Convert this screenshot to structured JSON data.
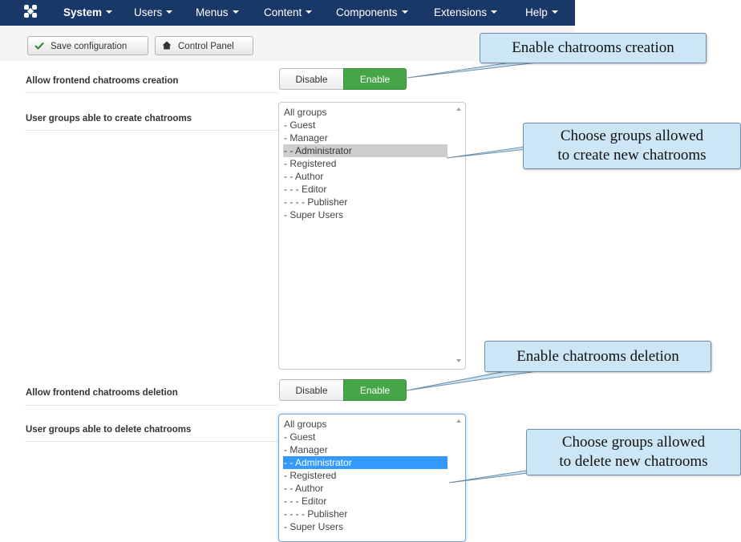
{
  "navbar": {
    "logo_icon": "joomla-logo-icon",
    "items": [
      {
        "label": "System",
        "active": true
      },
      {
        "label": "Users"
      },
      {
        "label": "Menus"
      },
      {
        "label": "Content"
      },
      {
        "label": "Components"
      },
      {
        "label": "Extensions"
      },
      {
        "label": "Help"
      }
    ]
  },
  "toolbar": {
    "save_label": "Save configuration",
    "save_icon": "checkmark-icon",
    "control_panel_label": "Control Panel",
    "control_panel_icon": "home-icon"
  },
  "form": {
    "allow_creation": {
      "label": "Allow frontend chatrooms creation",
      "disable_label": "Disable",
      "enable_label": "Enable",
      "value": "Enable"
    },
    "create_groups": {
      "label": "User groups able to create chatrooms",
      "options": [
        "All groups",
        "- Guest",
        "- Manager",
        "- - Administrator",
        "- Registered",
        "- - Author",
        "- - - Editor",
        "- - - - Publisher",
        "- Super Users"
      ],
      "selected": "- - Administrator"
    },
    "allow_deletion": {
      "label": "Allow frontend chatrooms deletion",
      "disable_label": "Disable",
      "enable_label": "Enable",
      "value": "Enable"
    },
    "delete_groups": {
      "label": "User groups able to delete chatrooms",
      "options": [
        "All groups",
        "- Guest",
        "- Manager",
        "- - Administrator",
        "- Registered",
        "- - Author",
        "- - - Editor",
        "- - - - Publisher",
        "- Super Users"
      ],
      "selected": "- - Administrator"
    }
  },
  "callouts": {
    "enable_creation": "Enable chatrooms creation",
    "choose_create_line1": "Choose groups allowed",
    "choose_create_line2": "to create new chatrooms",
    "enable_deletion": "Enable chatrooms deletion",
    "choose_delete_line1": "Choose groups allowed",
    "choose_delete_line2": "to delete new chatrooms"
  },
  "colors": {
    "navbar": "#1a3867",
    "enable_active": "#46a546",
    "selection_blue": "#3399ff",
    "callout_fill": "#cce6f5"
  }
}
